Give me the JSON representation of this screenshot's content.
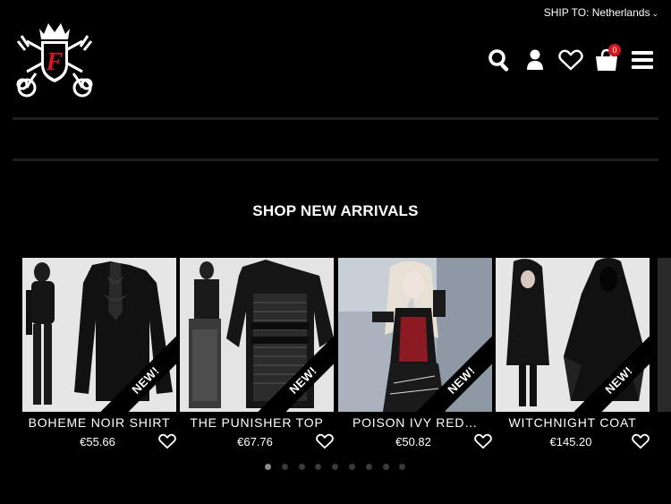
{
  "header": {
    "ship_label": "SHIP TO: Netherlands",
    "cart_count": "0",
    "icons": [
      "search-icon",
      "user-icon",
      "heart-icon",
      "cart-icon",
      "menu-icon"
    ],
    "logo_letter": "F"
  },
  "section": {
    "title": "SHOP NEW ARRIVALS"
  },
  "products": [
    {
      "name": "BOHEME NOIR SHIRT",
      "price": "€55.66",
      "badge": "NEW!"
    },
    {
      "name": "THE PUNISHER TOP",
      "price": "€67.76",
      "badge": "NEW!"
    },
    {
      "name": "POISON IVY RED…",
      "price": "€50.82",
      "badge": "NEW!"
    },
    {
      "name": "WITCHNIGHT COAT",
      "price": "€145.20",
      "badge": "NEW!"
    }
  ],
  "carousel": {
    "pages": 9,
    "active_page": 1
  },
  "colors": {
    "background": "#000000",
    "badge_red": "#d8141e",
    "logo_red": "#d8141e"
  }
}
